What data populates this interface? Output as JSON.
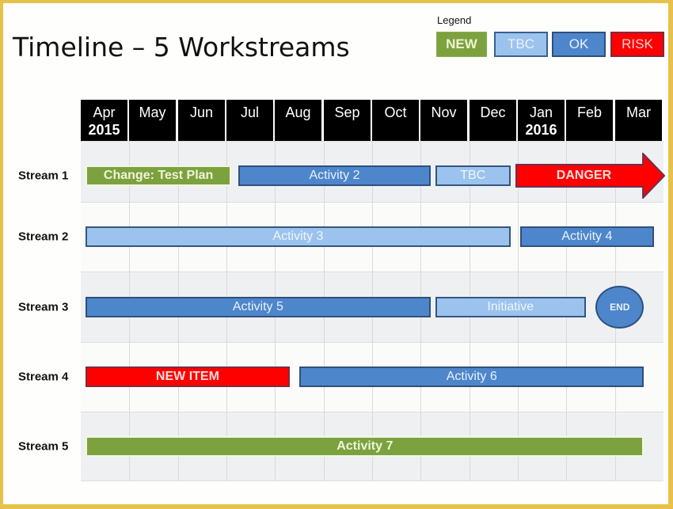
{
  "title": "Timeline – 5 Workstreams",
  "legend": {
    "label": "Legend",
    "items": [
      {
        "key": "new",
        "label": "NEW",
        "color": "#7ba23f"
      },
      {
        "key": "tbc",
        "label": "TBC",
        "color": "#9cc3ee"
      },
      {
        "key": "ok",
        "label": "OK",
        "color": "#4e86cb"
      },
      {
        "key": "risk",
        "label": "RISK",
        "color": "#ff0000"
      }
    ]
  },
  "months": [
    {
      "label": "Apr",
      "year": "2015"
    },
    {
      "label": "May",
      "year": ""
    },
    {
      "label": "Jun",
      "year": ""
    },
    {
      "label": "Jul",
      "year": ""
    },
    {
      "label": "Aug",
      "year": ""
    },
    {
      "label": "Sep",
      "year": ""
    },
    {
      "label": "Oct",
      "year": ""
    },
    {
      "label": "Nov",
      "year": ""
    },
    {
      "label": "Dec",
      "year": ""
    },
    {
      "label": "Jan",
      "year": "2016"
    },
    {
      "label": "Feb",
      "year": ""
    },
    {
      "label": "Mar",
      "year": ""
    }
  ],
  "streams": [
    {
      "label": "Stream 1",
      "items": [
        {
          "type": "bar",
          "status": "new",
          "label": "Change: Test Plan",
          "start": 0.1,
          "end": 3.1
        },
        {
          "type": "bar",
          "status": "ok",
          "label": "Activity 2",
          "start": 3.25,
          "end": 7.2
        },
        {
          "type": "bar",
          "status": "tbc",
          "label": "TBC",
          "start": 7.3,
          "end": 8.85
        },
        {
          "type": "arrow",
          "status": "risk",
          "label": "DANGER",
          "start": 8.95,
          "end": 12.0
        }
      ]
    },
    {
      "label": "Stream 2",
      "items": [
        {
          "type": "bar",
          "status": "tbc",
          "label": "Activity 3",
          "start": 0.1,
          "end": 8.85
        },
        {
          "type": "bar",
          "status": "ok",
          "label": "Activity 4",
          "start": 9.05,
          "end": 11.8
        }
      ]
    },
    {
      "label": "Stream 3",
      "items": [
        {
          "type": "bar",
          "status": "ok",
          "label": "Activity 5",
          "start": 0.1,
          "end": 7.2
        },
        {
          "type": "bar",
          "status": "tbc",
          "label": "Initiative",
          "start": 7.3,
          "end": 10.4
        },
        {
          "type": "milestone",
          "status": "ok",
          "label": "END",
          "start": 10.6,
          "end": 11.6
        }
      ]
    },
    {
      "label": "Stream 4",
      "items": [
        {
          "type": "bar",
          "status": "risk",
          "label": "NEW ITEM",
          "start": 0.1,
          "end": 4.3
        },
        {
          "type": "bar",
          "status": "ok",
          "label": "Activity 6",
          "start": 4.5,
          "end": 11.6
        }
      ]
    },
    {
      "label": "Stream 5",
      "items": [
        {
          "type": "bar",
          "status": "new",
          "label": "Activity 7",
          "start": 0.1,
          "end": 11.6
        }
      ]
    }
  ]
}
